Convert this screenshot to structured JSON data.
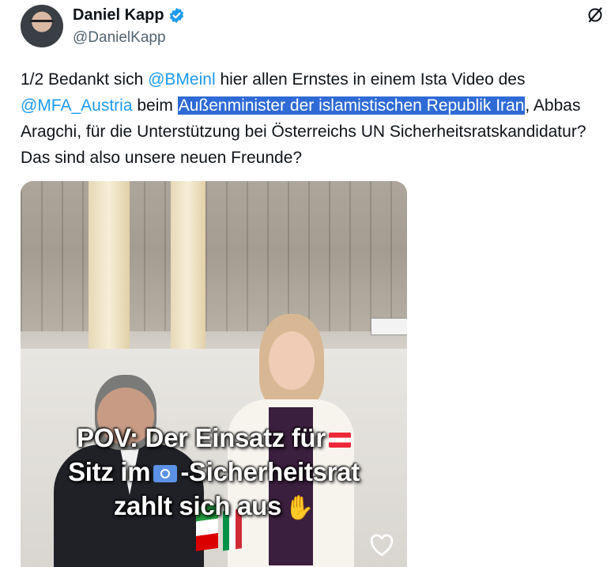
{
  "author": {
    "name": "Daniel Kapp",
    "handle": "@DanielKapp",
    "verified_icon": "verified-badge-icon"
  },
  "actions": {
    "grok_icon": "grok-icon"
  },
  "tweet": {
    "t1": "1/2 Bedankt sich ",
    "mention1": "@BMeinl",
    "t2": " hier allen Ernstes in einem Ista Video des ",
    "mention2": "@MFA_Austria",
    "t3": " beim ",
    "highlighted": "Außenminister der islamistischen Republik Iran",
    "t4": ", Abbas Aragchi, für die Unterstützung bei Österreichs UN Sicherheitsratskandidatur? Das sind also unsere neuen Freunde?"
  },
  "media": {
    "caption_line1": "POV: Der Einsatz für",
    "caption_line2a": "Sitz im",
    "caption_line2b": "-Sicherheitsrat",
    "caption_line3": "zahlt sich aus",
    "flag_emoji": "austria-flag-emoji",
    "un_emoji": "un-flag-emoji",
    "hands_emoji": "handshake-emoji",
    "like_icon": "heart-icon"
  },
  "colors": {
    "link": "#1d9bf0",
    "highlight": "#2f6bd6",
    "verified": "#1d9bf0"
  }
}
